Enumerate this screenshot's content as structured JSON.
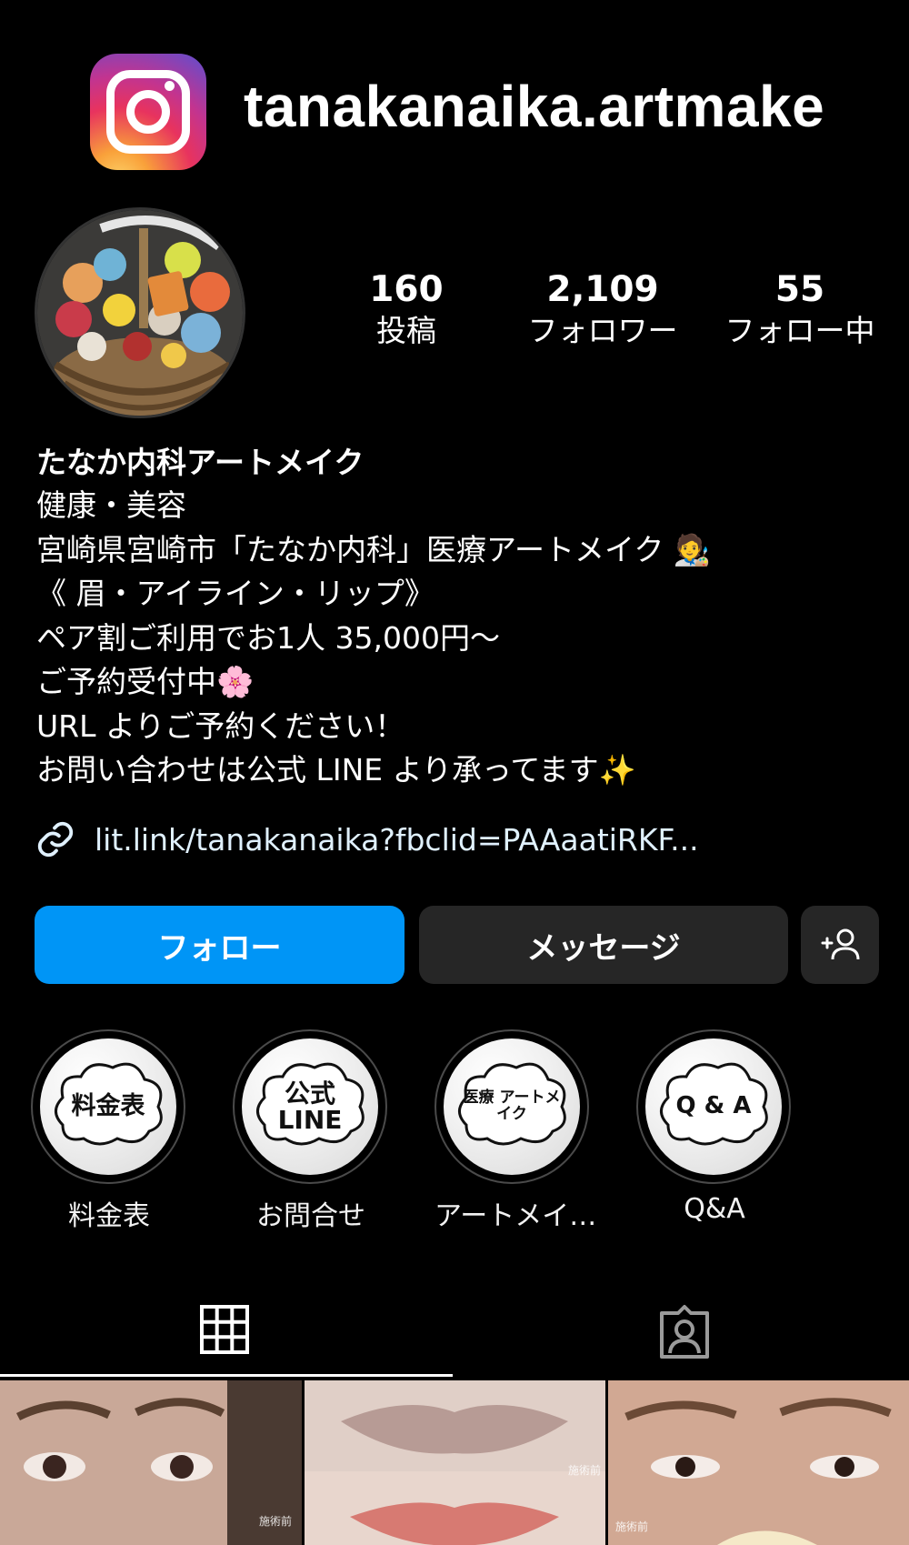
{
  "header": {
    "handle": "tanakanaika.artmake",
    "logo_icon": "instagram-logo-icon"
  },
  "profile": {
    "stats": [
      {
        "value": "160",
        "label": "投稿"
      },
      {
        "value": "2,109",
        "label": "フォロワー"
      },
      {
        "value": "55",
        "label": "フォロー中"
      }
    ],
    "name": "たなか内科アートメイク",
    "bio_lines": [
      "健康・美容",
      "宮崎県宮崎市「たなか内科」医療アートメイク",
      "《 眉・アイライン・リップ》",
      "ペア割ご利用でお1人 35,000円〜",
      "ご予約受付中",
      "URL よりご予約ください！",
      "お問い合わせは公式 LINE より承ってます"
    ],
    "link": "lit.link/tanakanaika?fbclid=PAAaatiRKF..."
  },
  "actions": {
    "follow": "フォロー",
    "message": "メッセージ",
    "add_user": "+人"
  },
  "highlights": [
    {
      "cover": "料金表",
      "label": "料金表"
    },
    {
      "cover": "公式 LINE",
      "label": "お問合せ"
    },
    {
      "cover": "医療 アートメイク",
      "label": "アートメイ…"
    },
    {
      "cover": "Q & A",
      "label": "Q&A"
    }
  ],
  "posts": [
    {
      "tag": "施術前"
    },
    {
      "tag": "施術前"
    },
    {
      "tag": "施術前"
    }
  ],
  "colors": {
    "follow": "#0095f6",
    "button_dark": "#262626",
    "background": "#000000"
  }
}
